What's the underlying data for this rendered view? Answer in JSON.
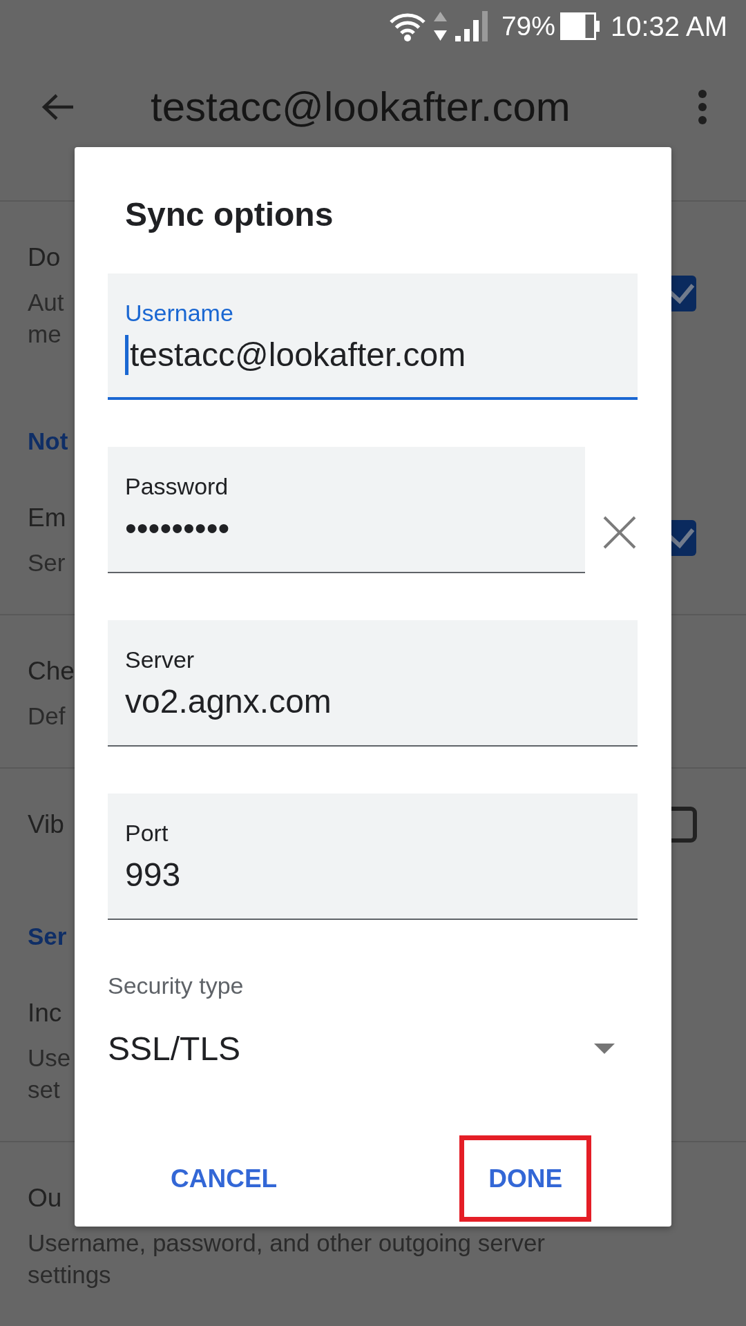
{
  "status_bar": {
    "battery": "79%",
    "time": "10:32 AM"
  },
  "app_bar": {
    "title": "testacc@lookafter.com"
  },
  "settings": {
    "sections": [
      {
        "items": [
          {
            "kind": "checkbox",
            "title": "Do",
            "subtitle_lines": [
              "Aut",
              "me"
            ],
            "checked": true
          }
        ]
      },
      {
        "header": "Not",
        "items": [
          {
            "kind": "checkbox",
            "title": "Em",
            "subtitle_lines": [
              "Ser"
            ],
            "checked": true
          },
          {
            "kind": "plain",
            "title": "Che",
            "subtitle_lines": [
              "Def"
            ]
          },
          {
            "kind": "checkbox",
            "title": "Vib",
            "checked": false
          }
        ]
      },
      {
        "header": "Ser",
        "items": [
          {
            "kind": "plain",
            "title": "Inc",
            "subtitle_lines": [
              "Use",
              "set"
            ]
          },
          {
            "kind": "plain",
            "title": "Ou",
            "subtitle": "Username, password, and other outgoing server settings"
          }
        ]
      }
    ]
  },
  "dialog": {
    "title": "Sync options",
    "fields": [
      {
        "label": "Username",
        "value": "testacc@lookafter.com",
        "focused": true,
        "clearable": false
      },
      {
        "label": "Password",
        "value": "•••••••••",
        "focused": false,
        "clearable": true
      },
      {
        "label": "Server",
        "value": "vo2.agnx.com",
        "focused": false,
        "clearable": false
      },
      {
        "label": "Port",
        "value": "993",
        "focused": false,
        "clearable": false
      }
    ],
    "security": {
      "label": "Security type",
      "value": "SSL/TLS"
    },
    "buttons": [
      {
        "label": "CANCEL",
        "highlighted": false
      },
      {
        "label": "DONE",
        "highlighted": true
      }
    ]
  }
}
